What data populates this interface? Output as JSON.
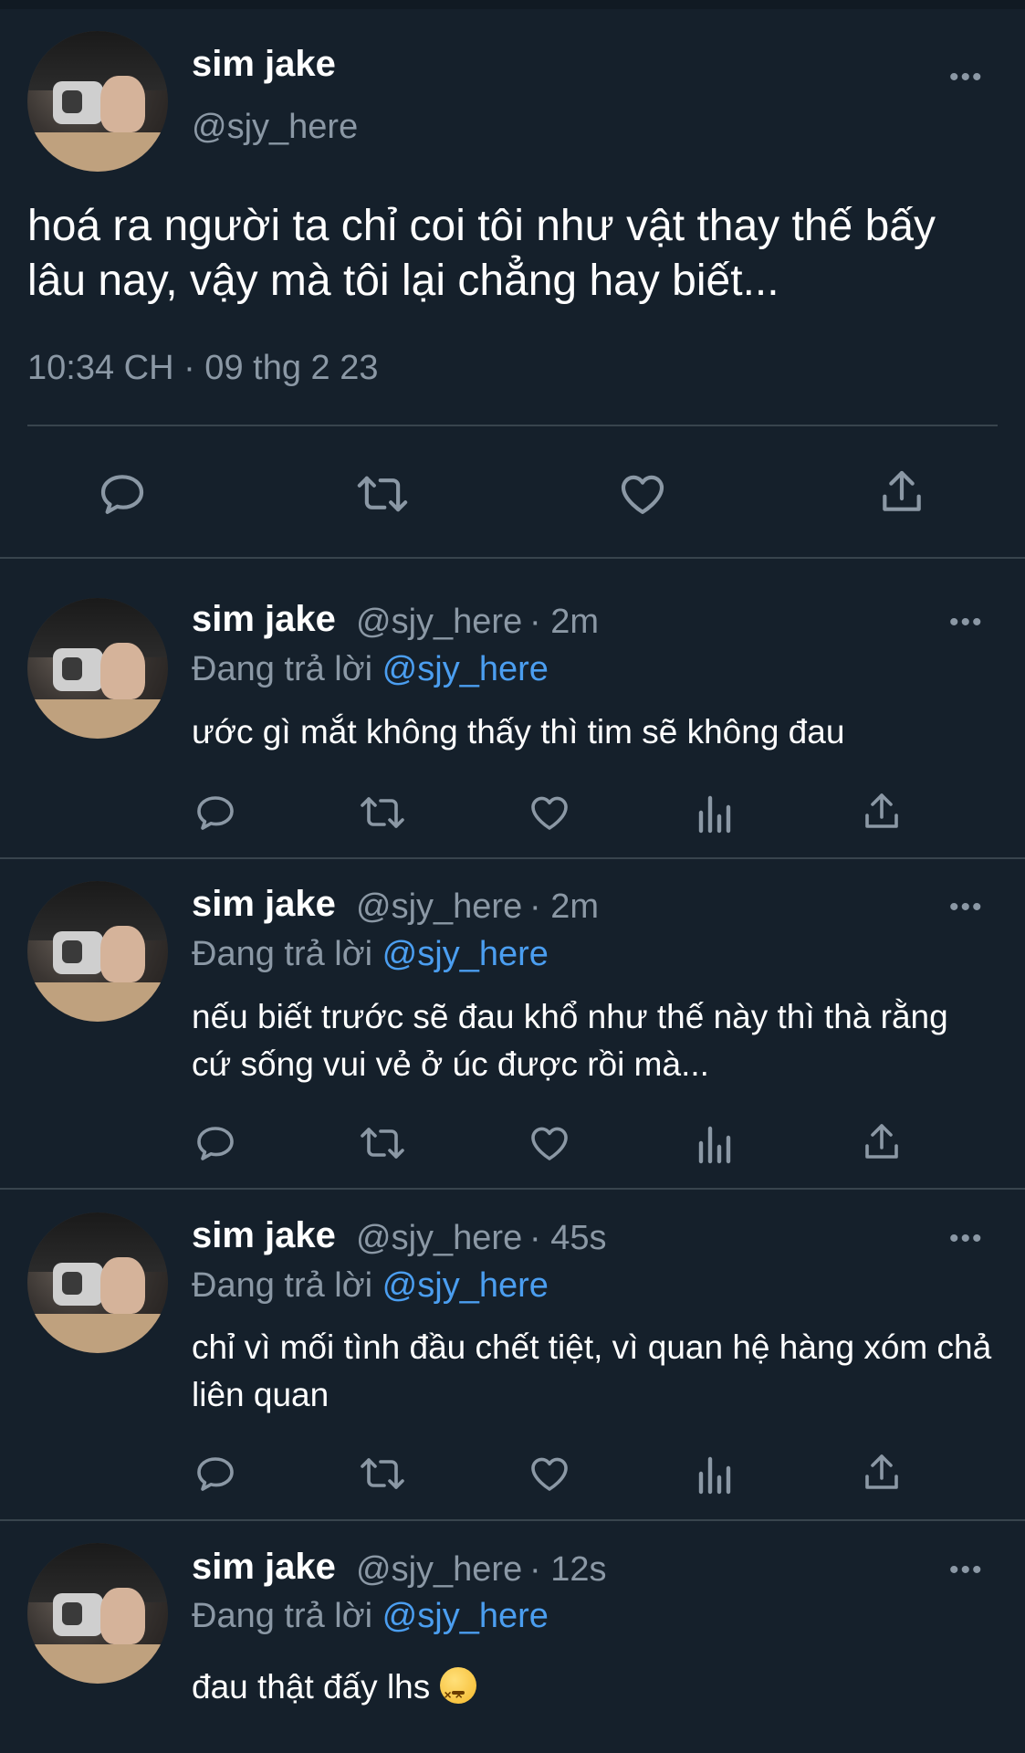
{
  "main_tweet": {
    "name": "sim jake",
    "handle": "@sjy_here",
    "text": "hoá ra người ta chỉ coi tôi như vật thay thế bấy lâu nay, vậy mà tôi lại chẳng hay biết...",
    "timestamp": "10:34 CH · 09 thg 2 23",
    "more_label": "•••"
  },
  "replying_to_label": "Đang trả lời",
  "replies": [
    {
      "name": "sim jake",
      "handle": "@sjy_here",
      "time": "· 2m",
      "reply_to": "@sjy_here",
      "text": "ước gì mắt không thấy thì tim sẽ không đau"
    },
    {
      "name": "sim jake",
      "handle": "@sjy_here",
      "time": "· 2m",
      "reply_to": "@sjy_here",
      "text": "nếu biết trước sẽ đau khổ như thế này thì thà rằng cứ sống vui vẻ ở úc được rồi mà..."
    },
    {
      "name": "sim jake",
      "handle": "@sjy_here",
      "time": "· 45s",
      "reply_to": "@sjy_here",
      "text": "chỉ vì mối tình đầu chết tiệt, vì quan hệ hàng xóm chả liên quan"
    },
    {
      "name": "sim jake",
      "handle": "@sjy_here",
      "time": "· 12s",
      "reply_to": "@sjy_here",
      "text": "đau thật đấy lhs"
    }
  ],
  "icons": {
    "reply": "reply-icon",
    "retweet": "retweet-icon",
    "like": "like-icon",
    "views": "views-icon",
    "share": "share-icon",
    "more": "more-icon",
    "emoji": "confounded-face-emoji"
  },
  "colors": {
    "background": "#15202b",
    "secondary_text": "#8b98a5",
    "link": "#4b9ef0",
    "divider": "#38444d"
  }
}
